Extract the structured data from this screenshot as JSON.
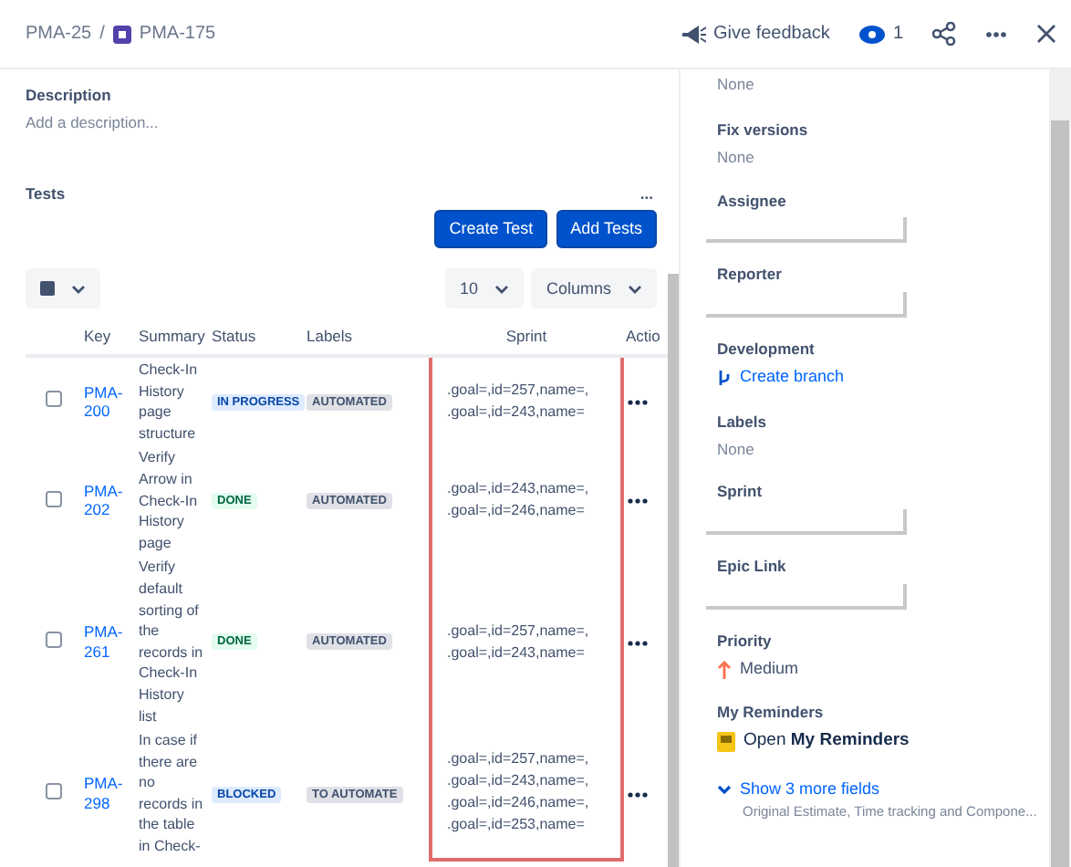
{
  "breadcrumbs": [
    {
      "text": "PMA-25",
      "icon": false
    },
    {
      "text": "PMA-175",
      "icon": true
    }
  ],
  "breadcrumb_separator": "/",
  "header": {
    "feedback": "Give feedback",
    "watchers": "1"
  },
  "description": {
    "label": "Description",
    "placeholder": "Add a description..."
  },
  "tests": {
    "title": "Tests",
    "more": "...",
    "buttons": [
      "Create Test",
      "Add Tests"
    ],
    "page_size": "10",
    "columns_label": "Columns",
    "columns": [
      "Key",
      "Summary",
      "Status",
      "Labels",
      "Sprint",
      "Actio"
    ],
    "rows": [
      {
        "checked": false,
        "key": "PMA-200",
        "summary": "Check-In History page structure",
        "status": {
          "text": "IN PROGRESS",
          "kind": "inprogress"
        },
        "label": "AUTOMATED",
        "sprint": [
          ".goal=,id=257,name=,",
          ".goal=,id=243,name="
        ]
      },
      {
        "checked": false,
        "key": "PMA-202",
        "summary": "Verify Arrow in Check-In History page",
        "status": {
          "text": "DONE",
          "kind": "done"
        },
        "label": "AUTOMATED",
        "sprint": [
          ".goal=,id=243,name=,",
          ".goal=,id=246,name="
        ]
      },
      {
        "checked": false,
        "key": "PMA-261",
        "summary": "Verify default sorting of the records in Check-In History list",
        "status": {
          "text": "DONE",
          "kind": "done"
        },
        "label": "AUTOMATED",
        "sprint": [
          ".goal=,id=257,name=,",
          ".goal=,id=243,name="
        ]
      },
      {
        "checked": false,
        "key": "PMA-298",
        "summary": "In case if there are no records in the table in Check-",
        "status": {
          "text": "BLOCKED",
          "kind": "blocked"
        },
        "label": "TO AUTOMATE",
        "sprint": [
          ".goal=,id=257,name=,",
          ".goal=,id=243,name=,",
          ".goal=,id=246,name=,",
          ".goal=,id=253,name="
        ]
      }
    ]
  },
  "side_fields": [
    {
      "kind": "value",
      "value": "None"
    },
    {
      "kind": "value",
      "label": "Fix versions",
      "value": "None"
    },
    {
      "kind": "blank",
      "label": "Assignee"
    },
    {
      "kind": "blank",
      "label": "Reporter"
    },
    {
      "kind": "link",
      "label": "Development",
      "value": "Create branch"
    },
    {
      "kind": "value",
      "label": "Labels",
      "value": "None"
    },
    {
      "kind": "blank",
      "label": "Sprint"
    },
    {
      "kind": "blank",
      "label": "Epic Link"
    },
    {
      "kind": "priority",
      "label": "Priority",
      "value": "Medium"
    },
    {
      "kind": "reminder",
      "label": "My Reminders",
      "value": "Open **My Reminders**"
    }
  ],
  "more_fields": {
    "link": "Show 3 more fields",
    "hint": "Original Estimate, Time tracking and Compone..."
  }
}
